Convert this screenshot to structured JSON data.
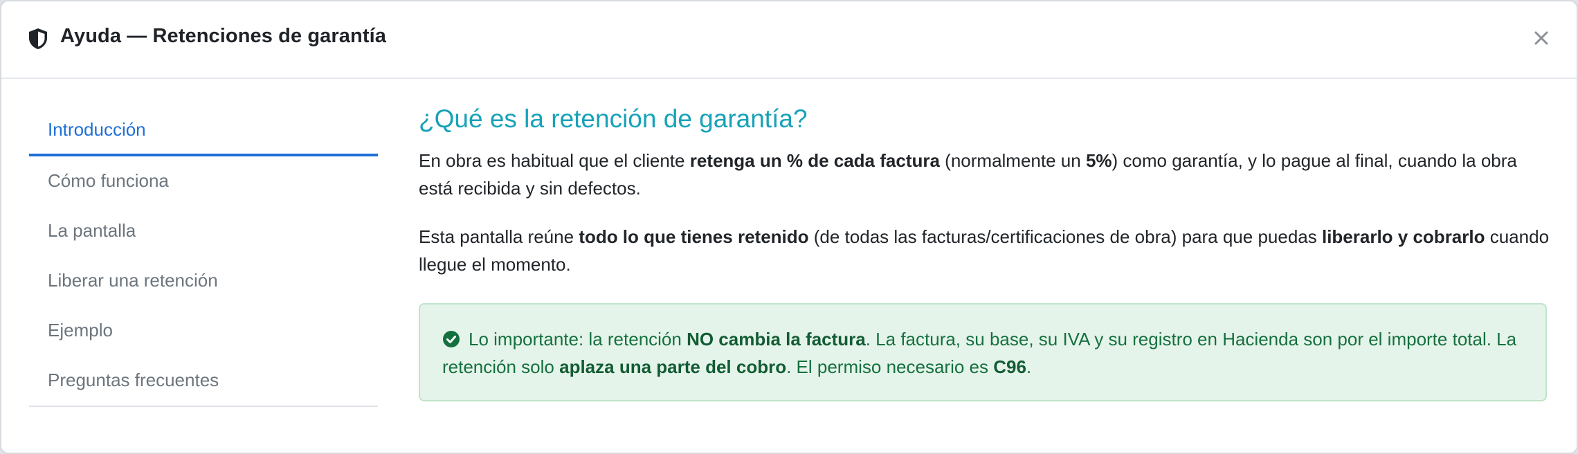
{
  "header": {
    "title": "Ayuda — Retenciones de garantía",
    "icon": "shield-icon",
    "close_icon": "close-icon"
  },
  "sidebar": {
    "items": [
      {
        "label": "Introducción",
        "active": true
      },
      {
        "label": "Cómo funciona",
        "active": false
      },
      {
        "label": "La pantalla",
        "active": false
      },
      {
        "label": "Liberar una retención",
        "active": false
      },
      {
        "label": "Ejemplo",
        "active": false
      },
      {
        "label": "Preguntas frecuentes",
        "active": false
      }
    ]
  },
  "content": {
    "heading": "¿Qué es la retención de garantía?",
    "p1": {
      "t1": "En obra es habitual que el cliente ",
      "b1": "retenga un % de cada factura",
      "t2": " (normalmente un ",
      "b2": "5%",
      "t3": ") como garantía, y lo pague al final, cuando la obra está recibida y sin defectos."
    },
    "p2": {
      "t1": "Esta pantalla reúne ",
      "b1": "todo lo que tienes retenido",
      "t2": " (de todas las facturas/certificaciones de obra) para que puedas ",
      "b2": "liberarlo y cobrarlo",
      "t3": " cuando llegue el momento."
    },
    "alert": {
      "icon": "check-circle-icon",
      "t1": "Lo importante: la retención ",
      "b1": "NO cambia la factura",
      "t2": ". La factura, su base, su IVA y su registro en Hacienda son por el importe total. La retención solo ",
      "b2": "aplaza una parte del cobro",
      "t3": ". El permiso necesario es ",
      "b3": "C96",
      "t4": "."
    }
  },
  "colors": {
    "accent": "#1f6fd6",
    "heading": "#17a2b8",
    "alert_bg": "#e5f4ea",
    "alert_text": "#15703f"
  }
}
